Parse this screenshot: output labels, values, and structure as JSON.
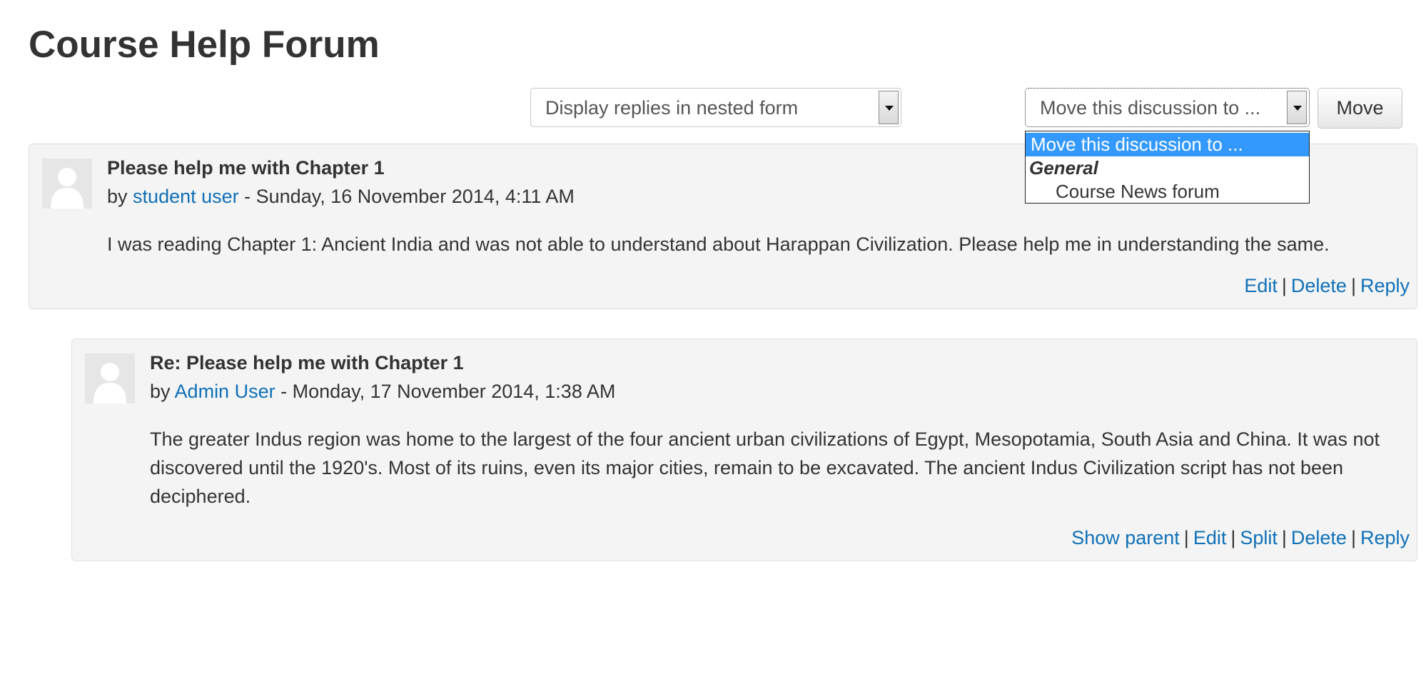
{
  "page": {
    "title": "Course Help Forum"
  },
  "controls": {
    "display_mode": {
      "selected": "Display replies in nested form"
    },
    "move_discussion": {
      "selected": "Move this discussion to ...",
      "options": {
        "placeholder": "Move this discussion to ...",
        "group_label": "General",
        "forum_option": "Course News forum"
      },
      "button_label": "Move"
    }
  },
  "posts": [
    {
      "subject": "Please help me with Chapter 1",
      "by_label": "by",
      "author": "student user",
      "date": " - Sunday, 16 November 2014, 4:11 AM",
      "message": "I was reading Chapter 1: Ancient India and was not able to understand about Harappan Civilization. Please help me in understanding the same.",
      "commands": {
        "edit": "Edit",
        "delete": "Delete",
        "reply": "Reply",
        "separator": "|"
      }
    },
    {
      "subject": "Re: Please help me with Chapter 1",
      "by_label": "by",
      "author": "Admin User",
      "date": " - Monday, 17 November 2014, 1:38 AM",
      "message": "The greater Indus region was home to the largest of the four ancient urban civilizations of Egypt, Mesopotamia, South Asia and China. It was not discovered until the 1920's. Most of its ruins, even its major cities, remain to be excavated. The ancient Indus Civilization script has not been deciphered.",
      "commands": {
        "show_parent": "Show parent",
        "edit": "Edit",
        "split": "Split",
        "delete": "Delete",
        "reply": "Reply",
        "separator": "|"
      }
    }
  ],
  "icons": {
    "avatar": "default-user-avatar-icon",
    "select_arrow": "chevron-down-icon"
  },
  "colors": {
    "link": "#0f70b7",
    "selected_option": "#3399ff",
    "post_background": "#f4f4f4"
  }
}
